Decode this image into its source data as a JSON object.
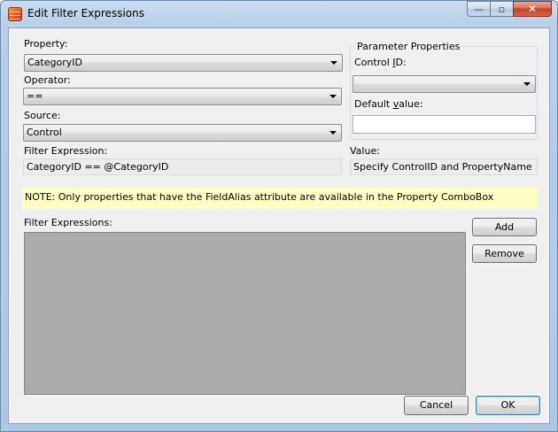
{
  "window": {
    "title": "Edit Filter Expressions",
    "caption_buttons": {
      "minimize": "—",
      "maximize": "▫",
      "close": "✕"
    }
  },
  "form": {
    "property_label": "Property:",
    "property_value": "CategoryID",
    "operator_label": "Operator:",
    "operator_value": "==",
    "source_label": "Source:",
    "source_value": "Control",
    "filter_expression_label": "Filter Expression:",
    "filter_expression_value": "CategoryID == @CategoryID",
    "value_label": "Value:",
    "value_value": "Specify ControlID and PropertyName"
  },
  "parameter_properties": {
    "group_title": "Parameter Properties",
    "control_id_label_a": "Control ",
    "control_id_label_u": "I",
    "control_id_label_b": "D:",
    "control_id_value": "",
    "default_value_label_a": "Default ",
    "default_value_label_u": "v",
    "default_value_label_b": "alue:",
    "default_value_value": ""
  },
  "note": "NOTE: Only properties that have the FieldAlias attribute are available in the Property ComboBox",
  "filter_expressions": {
    "label": "Filter Expressions:",
    "items": []
  },
  "buttons": {
    "add": "Add",
    "remove": "Remove",
    "cancel": "Cancel",
    "ok": "OK"
  }
}
